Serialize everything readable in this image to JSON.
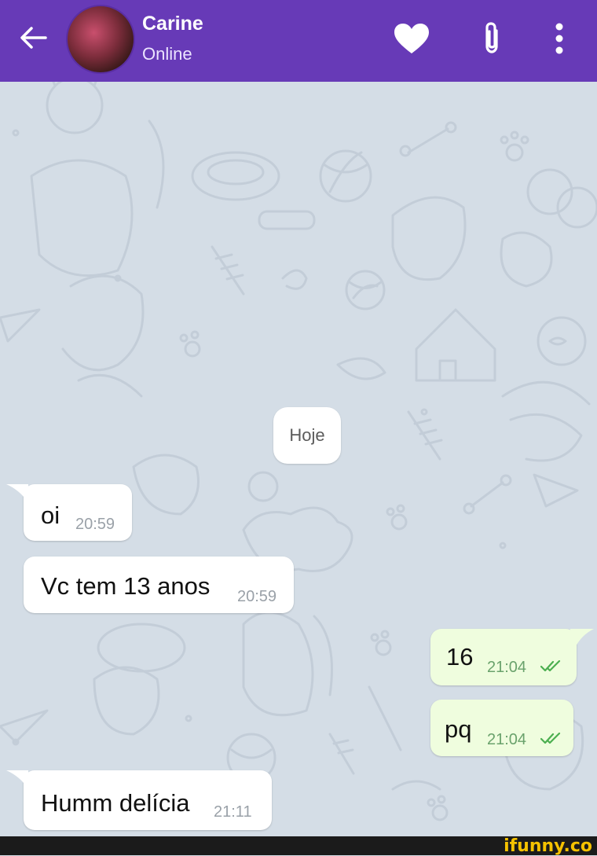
{
  "header": {
    "contact_name": "Carine",
    "status": "Online",
    "back_icon": "arrow-left-icon",
    "favorite_icon": "heart-icon",
    "attach_icon": "paperclip-icon",
    "menu_icon": "more-vertical-icon",
    "background_color": "#673ab7"
  },
  "chat": {
    "date_label": "Hoje",
    "messages": [
      {
        "direction": "incoming",
        "text": "oi",
        "time": "20:59"
      },
      {
        "direction": "incoming",
        "text": "Vc tem 13 anos",
        "time": "20:59"
      },
      {
        "direction": "outgoing",
        "text": "16",
        "time": "21:04",
        "status": "read-double-check"
      },
      {
        "direction": "outgoing",
        "text": "pq",
        "time": "21:04",
        "status": "read-double-check"
      },
      {
        "direction": "incoming",
        "text": "Humm delícia",
        "time": "21:11"
      }
    ]
  },
  "watermark": {
    "text": "ifunny.co",
    "color": "#f5c200"
  }
}
